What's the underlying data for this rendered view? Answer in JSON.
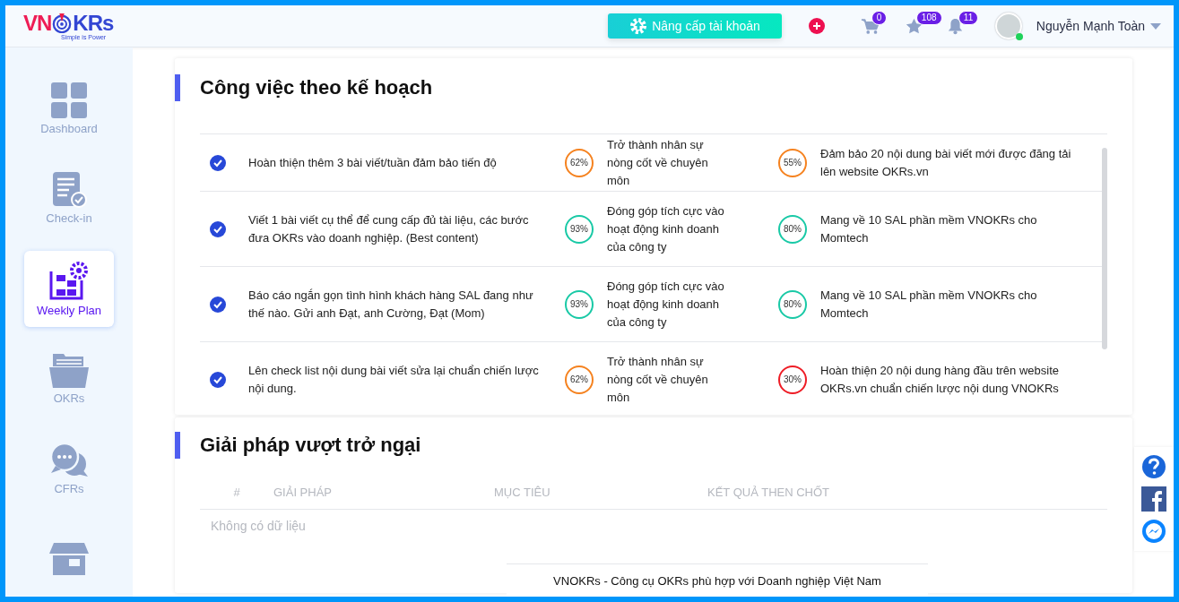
{
  "header": {
    "logo": {
      "left": "VN",
      "right": "KRs",
      "tagline": "Simple is Power"
    },
    "upgrade_button": "Nâng cấp tài khoản",
    "cart_badge": "0",
    "star_badge": "108",
    "bell_badge": "11",
    "user": {
      "name": "Nguyễn Mạnh Toàn",
      "online": true
    }
  },
  "sidebar": {
    "items": [
      {
        "label": "Dashboard",
        "selected": false
      },
      {
        "label": "Check-in",
        "selected": false
      },
      {
        "label": "Weekly Plan",
        "selected": true
      },
      {
        "label": "OKRs",
        "selected": false
      },
      {
        "label": "CFRs",
        "selected": false
      },
      {
        "selected": false
      }
    ]
  },
  "plan": {
    "title": "Công việc theo kế hoạch",
    "rows": [
      {
        "task": "Hoàn thiện thêm 3 bài viết/tuần đảm bảo tiến độ",
        "checked": true,
        "objective": {
          "reading": "62%",
          "color": "#f5821f",
          "text": "Trở thành nhân sự nòng cốt về chuyên môn"
        },
        "key_result": {
          "reading": "55%",
          "color": "#f5821f",
          "text": "Đảm bảo 20 nội dung bài viết mới được đăng tải lên website OKRs.vn"
        }
      },
      {
        "task": "Viết 1 bài viết cụ thể để cung cấp đủ tài liệu, các bước đưa OKRs vào doanh nghiệp. (Best content)",
        "checked": true,
        "objective": {
          "reading": "93%",
          "color": "#19c9a6",
          "text": "Đóng góp tích cực vào hoạt động kinh doanh của công ty"
        },
        "key_result": {
          "reading": "80%",
          "color": "#19c9a6",
          "text": "Mang về 10 SAL phần mềm VNOKRs cho Momtech"
        }
      },
      {
        "task": "Báo cáo ngắn gọn tình hình khách hàng SAL đang như thế nào. Gửi anh Đạt, anh Cường, Đạt (Mom)",
        "checked": true,
        "objective": {
          "reading": "93%",
          "color": "#19c9a6",
          "text": "Đóng góp tích cực vào hoạt động kinh doanh của công ty"
        },
        "key_result": {
          "reading": "80%",
          "color": "#19c9a6",
          "text": "Mang về 10 SAL phần mềm VNOKRs cho Momtech"
        }
      },
      {
        "task": "Lên check list nội dung bài viết sửa lại chuẩn chiến lược nội dung.",
        "checked": true,
        "objective": {
          "reading": "62%",
          "color": "#f5821f",
          "text": "Trở thành nhân sự nòng cốt về chuyên môn"
        },
        "key_result": {
          "reading": "30%",
          "color": "#ee1c25",
          "text": "Hoàn thiện 20 nội dung hàng đầu trên website OKRs.vn chuẩn chiến lược nội dung VNOKRs"
        }
      }
    ]
  },
  "obstacles": {
    "title": "Giải pháp vượt trở ngại",
    "columns": [
      "#",
      "GIẢI PHÁP",
      "MỤC TIÊU",
      "KẾT QUẢ THEN CHỐT"
    ],
    "empty_text": "Không có dữ liệu"
  },
  "footer": "VNOKRs - Công cụ OKRs phù hợp với Doanh nghiệp Việt Nam"
}
